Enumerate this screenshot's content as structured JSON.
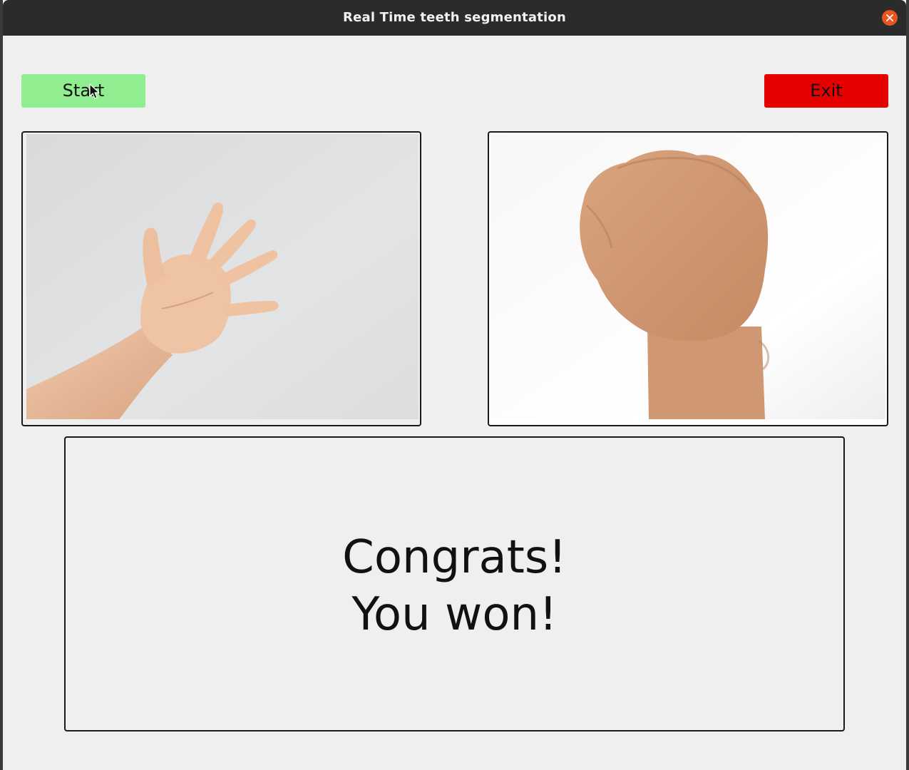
{
  "window": {
    "title": "Real Time teeth segmentation"
  },
  "controls": {
    "start_label": "Start",
    "exit_label": "Exit",
    "start_color": "#90ee90",
    "exit_color": "#e60000"
  },
  "panels": {
    "player_image": "open-hand-paper-gesture",
    "computer_image": "closed-fist-rock-gesture"
  },
  "result": {
    "line1": "Congrats!",
    "line2": "You won!"
  },
  "icons": {
    "close": "close-icon",
    "cursor": "mouse-pointer-icon"
  }
}
